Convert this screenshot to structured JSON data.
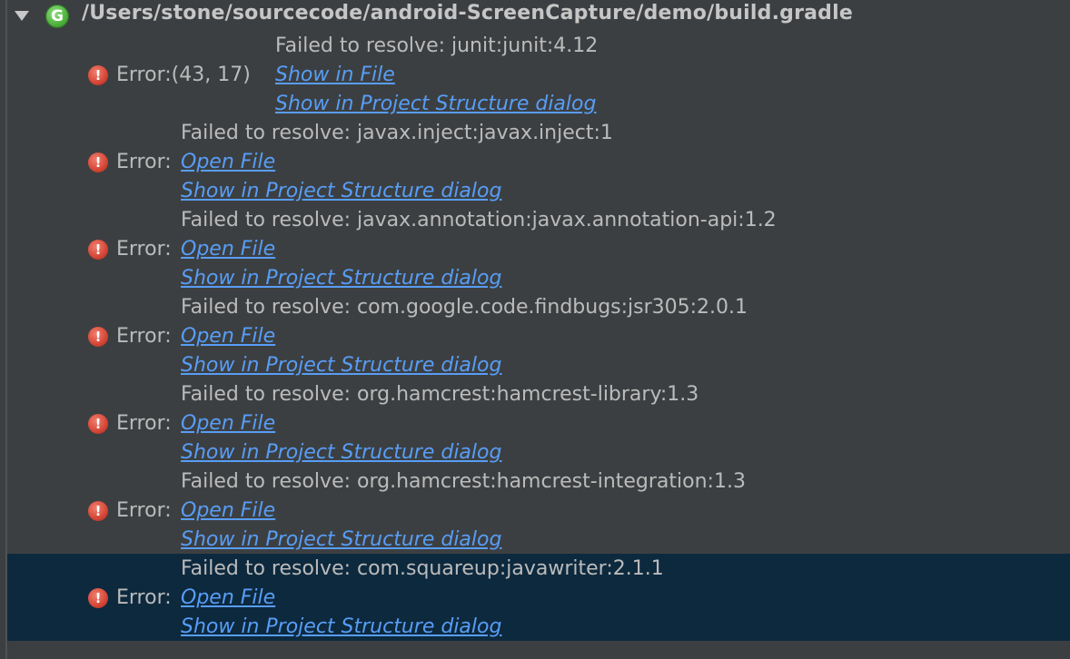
{
  "header": {
    "path": "/Users/stone/sourcecode/android-ScreenCapture/demo/build.gradle",
    "gradle_icon_letter": "G"
  },
  "error_icon_glyph": "!",
  "first_entry": {
    "message": "Failed to resolve: junit:junit:4.12",
    "error_label": "Error:(43, 17)",
    "link1": "Show in File",
    "link2": "Show in Project Structure dialog"
  },
  "entries": [
    {
      "message": "Failed to resolve: javax.inject:javax.inject:1",
      "error_label": "Error:",
      "link1": "Open File",
      "link2": "Show in Project Structure dialog"
    },
    {
      "message": "Failed to resolve: javax.annotation:javax.annotation-api:1.2",
      "error_label": "Error:",
      "link1": "Open File",
      "link2": "Show in Project Structure dialog"
    },
    {
      "message": "Failed to resolve: com.google.code.findbugs:jsr305:2.0.1",
      "error_label": "Error:",
      "link1": "Open File",
      "link2": "Show in Project Structure dialog"
    },
    {
      "message": "Failed to resolve: org.hamcrest:hamcrest-library:1.3",
      "error_label": "Error:",
      "link1": "Open File",
      "link2": "Show in Project Structure dialog"
    },
    {
      "message": "Failed to resolve: org.hamcrest:hamcrest-integration:1.3",
      "error_label": "Error:",
      "link1": "Open File",
      "link2": "Show in Project Structure dialog"
    },
    {
      "message": "Failed to resolve: com.squareup:javawriter:2.1.1",
      "error_label": "Error:",
      "link1": "Open File",
      "link2": "Show in Project Structure dialog",
      "selected": true
    }
  ],
  "colors": {
    "background": "#3c3f41",
    "link": "#589df6",
    "selection": "#0d293e",
    "error": "#d84a3a",
    "gradle": "#4caf3a"
  }
}
